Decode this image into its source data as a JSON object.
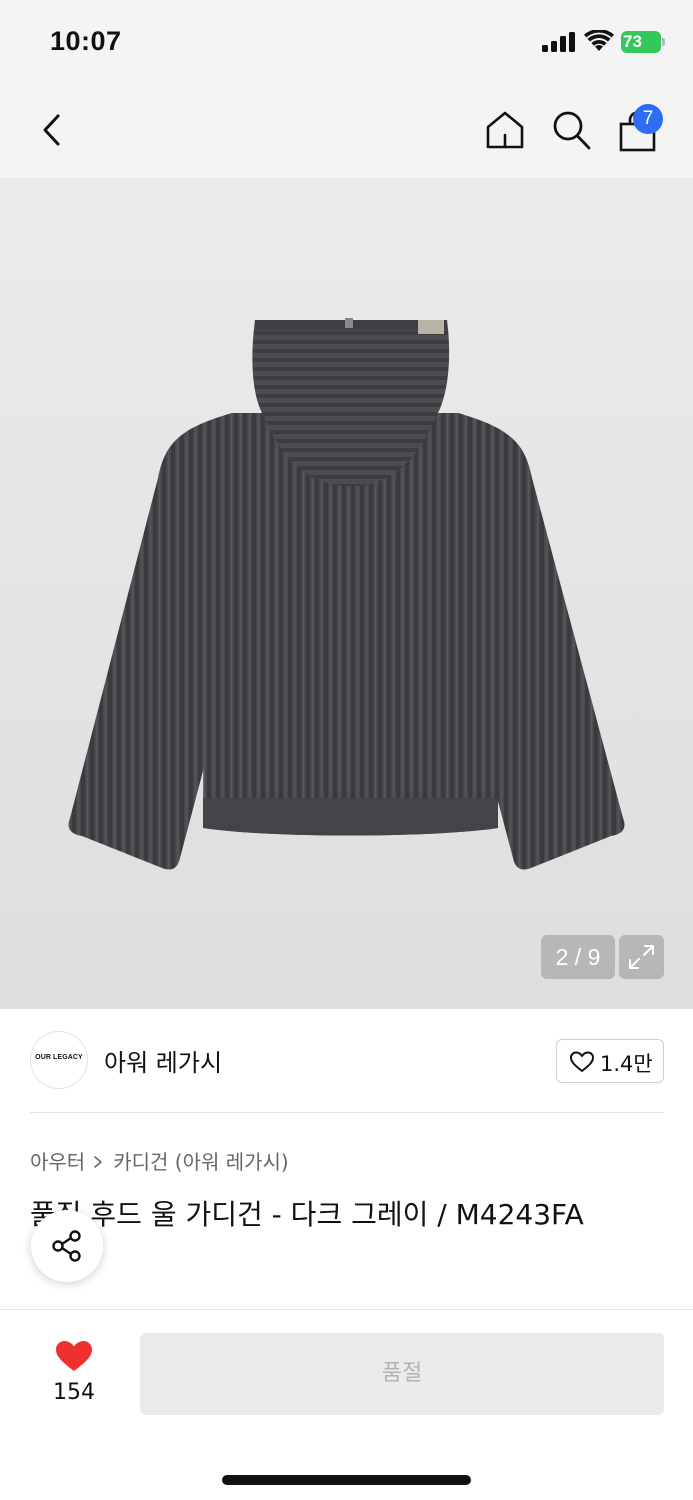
{
  "status_bar": {
    "time": "10:07",
    "battery_level": "73",
    "icons": [
      "cellular-signal-icon",
      "wifi-icon",
      "battery-charging-icon"
    ]
  },
  "nav": {
    "icons": [
      "back-chevron-icon",
      "home-icon",
      "search-icon",
      "shopping-bag-icon"
    ],
    "cart_badge": "7",
    "badge_color": "#2f6cf5"
  },
  "gallery": {
    "counter": "2 / 9",
    "icons": [
      "expand-icon"
    ]
  },
  "brand": {
    "logo_text": "OUR LEGACY",
    "name": "아워 레가시",
    "like_count": "1.4만"
  },
  "product": {
    "breadcrumb": [
      "아우터",
      "카디건 (아워 레가시)"
    ],
    "title": "풀집 후드 울 가디건 - 다크 그레이 / M4243FA"
  },
  "bottom_bar": {
    "wish_count": "154",
    "wish_color": "#f0302c",
    "sold_out_label": "품절"
  }
}
